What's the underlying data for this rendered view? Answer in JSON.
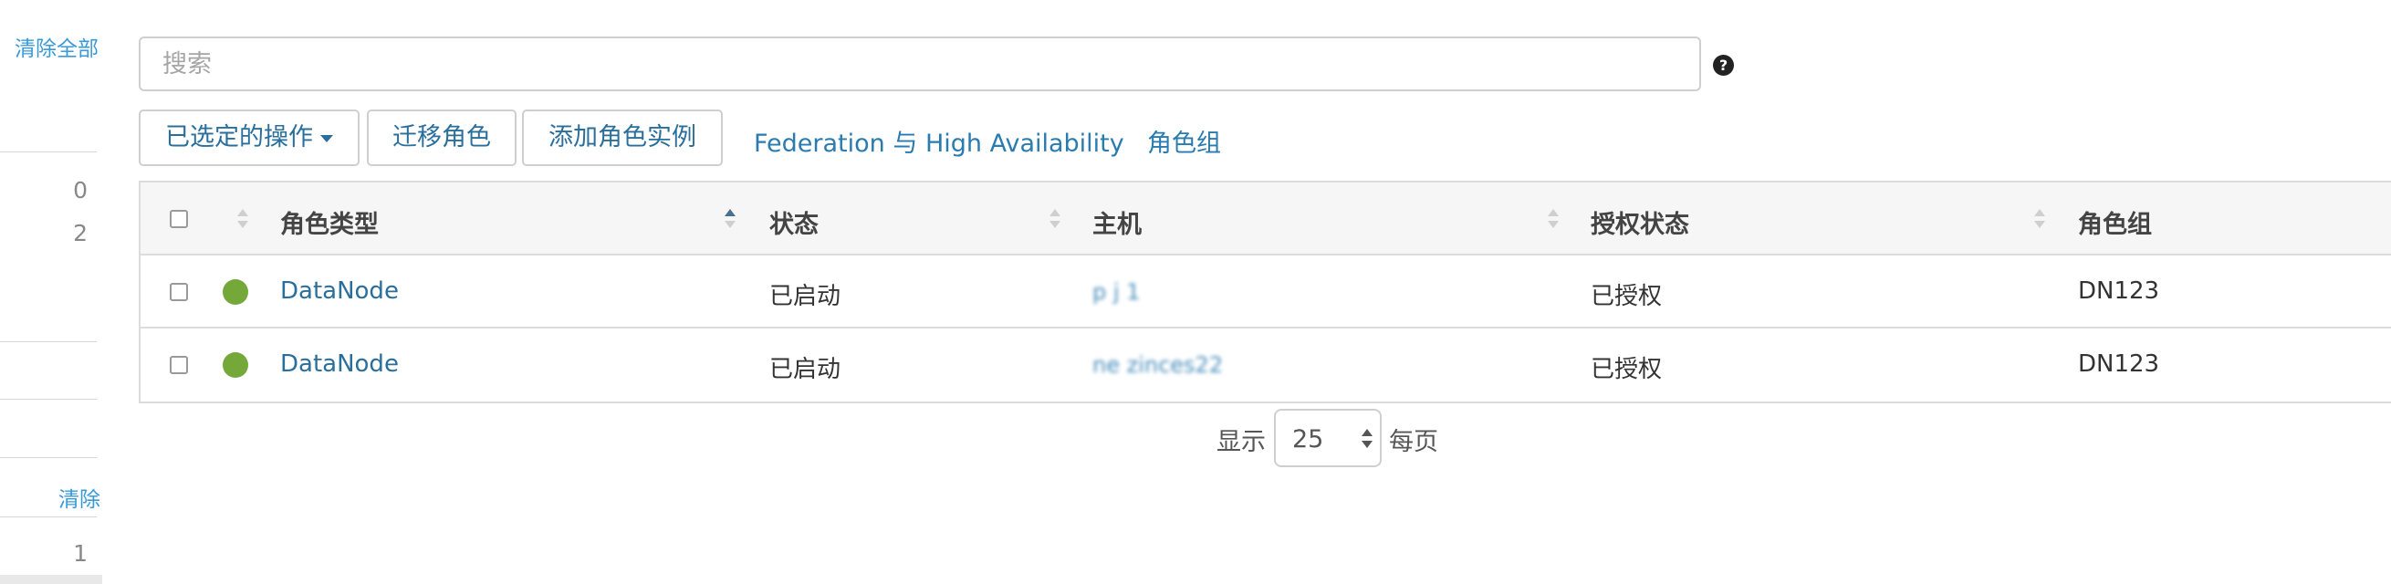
{
  "filters": {
    "clear_all": "清除全部",
    "count_0": "0",
    "count_2": "2",
    "clear": "清除",
    "count_1": "1"
  },
  "search": {
    "placeholder": "搜索",
    "help_icon": "question-circle-icon",
    "help_glyph": "?"
  },
  "toolbar": {
    "selected_actions": "已选定的操作",
    "migrate_roles": "迁移角色",
    "add_role_instances": "添加角色实例",
    "federation_ha": "Federation 与 High Availability",
    "role_groups": "角色组"
  },
  "table": {
    "columns": [
      "角色类型",
      "状态",
      "主机",
      "授权状态",
      "角色组"
    ],
    "rows": [
      {
        "role_type": "DataNode",
        "status": "已启动",
        "status_color": "#74a838",
        "host": "p  j    1",
        "commission_state": "已授权",
        "role_group": "DN123"
      },
      {
        "role_type": "DataNode",
        "status": "已启动",
        "status_color": "#74a838",
        "host": "ne zinces22",
        "commission_state": "已授权",
        "role_group": "DN123"
      }
    ]
  },
  "pagination": {
    "show_label": "显示",
    "page_size": "25",
    "per_page_label": "每页"
  }
}
